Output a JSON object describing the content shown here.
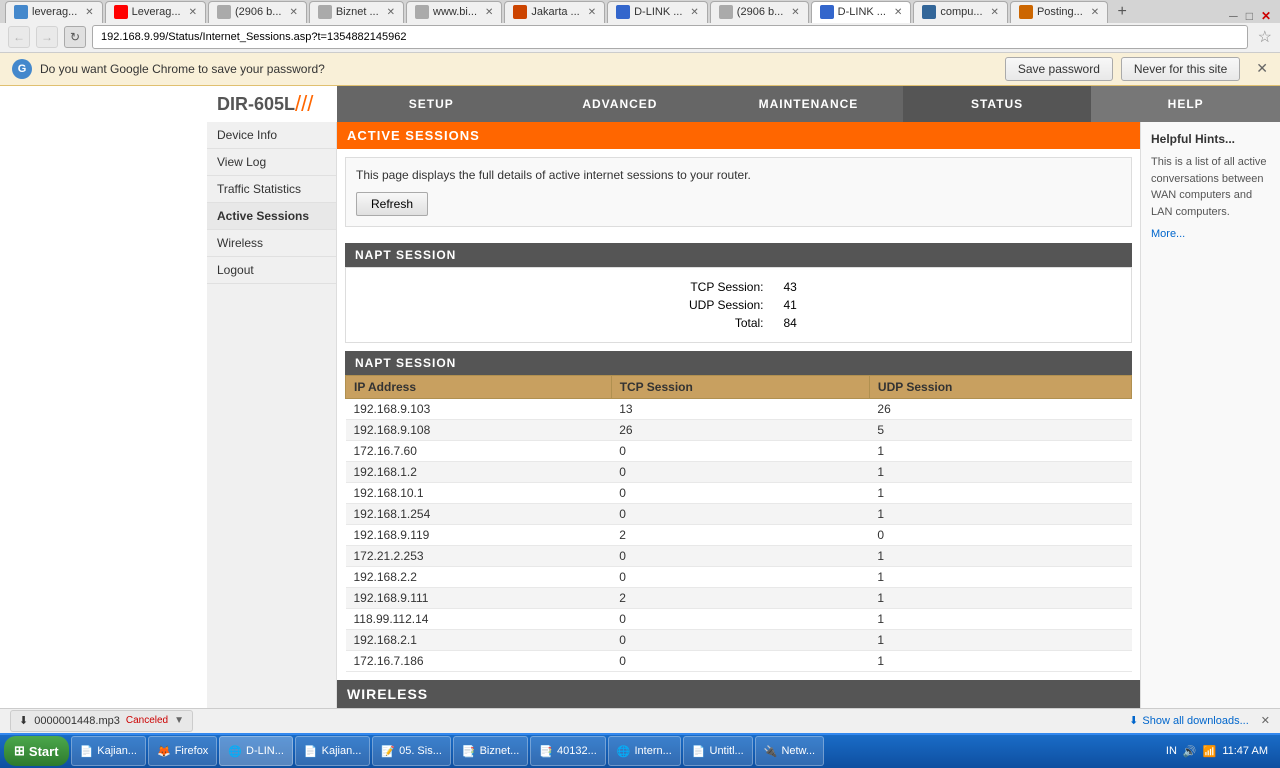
{
  "browser": {
    "tabs": [
      {
        "label": "leverag...",
        "favicon_color": "#4488cc",
        "active": false
      },
      {
        "label": "Leverag...",
        "favicon_color": "#ff0000",
        "active": false
      },
      {
        "label": "(2906 b...",
        "favicon_color": "#aaaaaa",
        "active": false
      },
      {
        "label": "Biznet ...",
        "favicon_color": "#aaaaaa",
        "active": false
      },
      {
        "label": "www.bi...",
        "favicon_color": "#aaaaaa",
        "active": false
      },
      {
        "label": "Jakarta ...",
        "favicon_color": "#cc4400",
        "active": false
      },
      {
        "label": "D-LINK ...",
        "favicon_color": "#3366cc",
        "active": false
      },
      {
        "label": "(2906 b...",
        "favicon_color": "#aaaaaa",
        "active": false
      },
      {
        "label": "D-LINK ...",
        "favicon_color": "#3366cc",
        "active": true
      },
      {
        "label": "compu...",
        "favicon_color": "#336699",
        "active": false
      },
      {
        "label": "Posting...",
        "favicon_color": "#cc6600",
        "active": false
      }
    ],
    "address": "192.168.9.99/Status/Internet_Sessions.asp?t=1354882145962",
    "password_prompt": "Do you want Google Chrome to save your password?",
    "save_password_label": "Save password",
    "never_label": "Never for this site"
  },
  "router": {
    "logo": "DIR-605L",
    "nav": {
      "setup": "SETUP",
      "advanced": "ADVANCED",
      "maintenance": "MAINTENANCE",
      "status": "STATUS",
      "help": "HELP"
    },
    "sidebar": {
      "items": [
        {
          "label": "Device Info"
        },
        {
          "label": "View Log"
        },
        {
          "label": "Traffic Statistics"
        },
        {
          "label": "Active Sessions"
        },
        {
          "label": "Wireless"
        },
        {
          "label": "Logout"
        }
      ]
    },
    "active_sessions": {
      "title": "ACTIVE SESSIONS",
      "description": "This page displays the full details of active internet sessions to your router.",
      "refresh_button": "Refresh",
      "napt_title": "NAPT SESSION",
      "tcp_label": "TCP Session:",
      "tcp_value": "43",
      "udp_label": "UDP Session:",
      "udp_value": "41",
      "total_label": "Total:",
      "total_value": "84",
      "table_title": "NAPT SESSION",
      "columns": {
        "ip": "IP Address",
        "tcp": "TCP Session",
        "udp": "UDP Session"
      },
      "rows": [
        {
          "ip": "192.168.9.103",
          "tcp": "13",
          "udp": "26"
        },
        {
          "ip": "192.168.9.108",
          "tcp": "26",
          "udp": "5"
        },
        {
          "ip": "172.16.7.60",
          "tcp": "0",
          "udp": "1"
        },
        {
          "ip": "192.168.1.2",
          "tcp": "0",
          "udp": "1"
        },
        {
          "ip": "192.168.10.1",
          "tcp": "0",
          "udp": "1"
        },
        {
          "ip": "192.168.1.254",
          "tcp": "0",
          "udp": "1"
        },
        {
          "ip": "192.168.9.119",
          "tcp": "2",
          "udp": "0"
        },
        {
          "ip": "172.21.2.253",
          "tcp": "0",
          "udp": "1"
        },
        {
          "ip": "192.168.2.2",
          "tcp": "0",
          "udp": "1"
        },
        {
          "ip": "192.168.9.111",
          "tcp": "2",
          "udp": "1"
        },
        {
          "ip": "118.99.112.14",
          "tcp": "0",
          "udp": "1"
        },
        {
          "ip": "192.168.2.1",
          "tcp": "0",
          "udp": "1"
        },
        {
          "ip": "172.16.7.186",
          "tcp": "0",
          "udp": "1"
        }
      ]
    },
    "help": {
      "title": "Helpful Hints...",
      "text": "This is a list of all active conversations between WAN computers and LAN computers.",
      "more": "More..."
    },
    "wireless_section": "WIRELESS"
  },
  "taskbar": {
    "start": "Start",
    "items": [
      {
        "label": "Kajian..."
      },
      {
        "label": "Firefox"
      },
      {
        "label": "D-LIN..."
      },
      {
        "label": "Kajian..."
      },
      {
        "label": "05. Sis..."
      },
      {
        "label": "Biznet..."
      },
      {
        "label": "40132..."
      },
      {
        "label": "Intern..."
      },
      {
        "label": "Untitl..."
      },
      {
        "label": "Netw..."
      }
    ],
    "time": "IN",
    "volume": "🔊",
    "clock": "11:47 AM"
  },
  "download": {
    "filename": "0000001448.mp3",
    "status": "Canceled",
    "show_all": "Show all downloads...",
    "arrow": "▼",
    "close": "✕"
  }
}
